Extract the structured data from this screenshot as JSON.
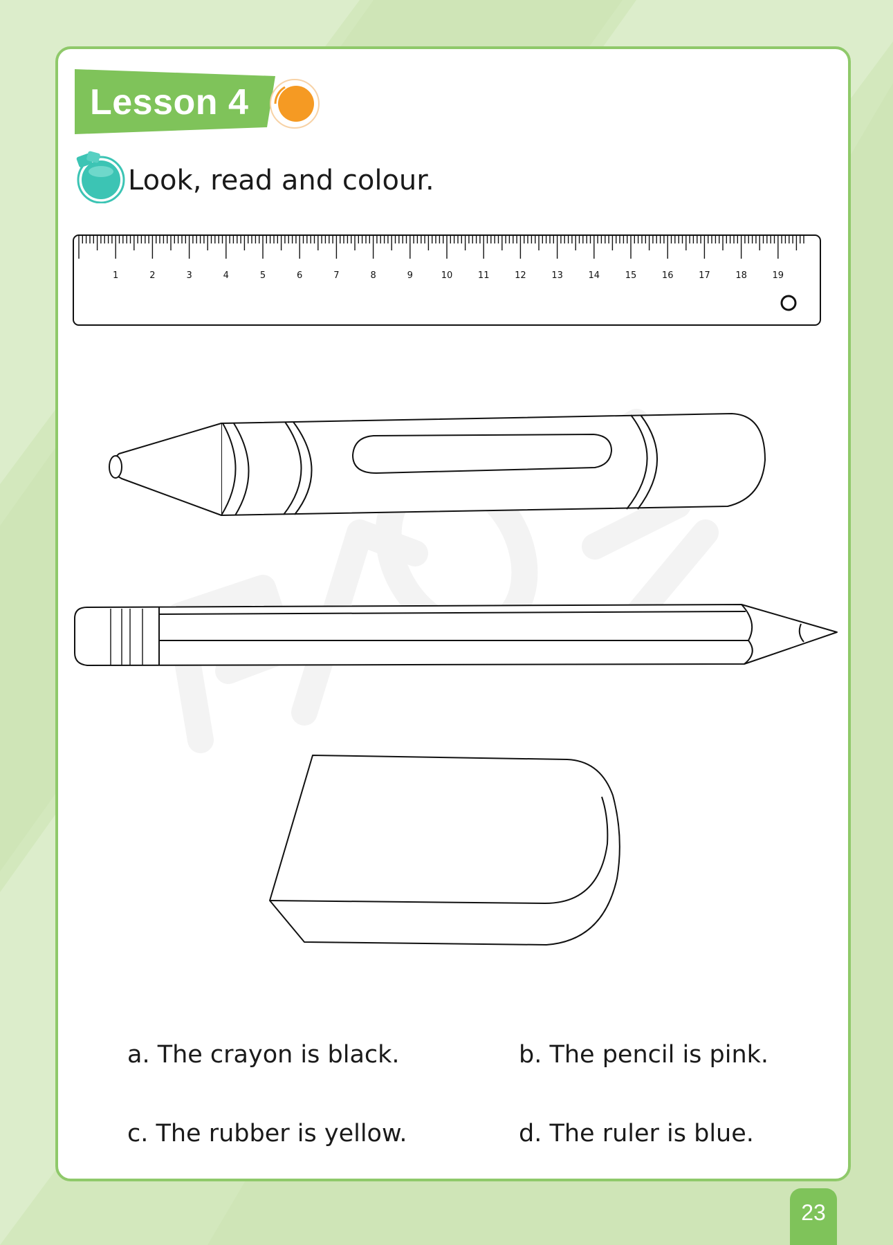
{
  "page": {
    "lesson_title": "Lesson 4",
    "instruction": "Look, read and colour.",
    "page_number": "23"
  },
  "ruler": {
    "ticks": [
      "1",
      "2",
      "3",
      "4",
      "5",
      "6",
      "7",
      "8",
      "9",
      "10",
      "11",
      "12",
      "13",
      "14",
      "15",
      "16",
      "17",
      "18",
      "19"
    ]
  },
  "sentences": [
    {
      "text": "a. The crayon is black."
    },
    {
      "text": "b. The pencil is pink."
    },
    {
      "text": "c. The rubber is yellow."
    },
    {
      "text": "d. The ruler is blue."
    }
  ],
  "colors": {
    "page_background": "#d3e8bd",
    "sheet_border": "#8fc96a",
    "banner_green": "#7fc35a",
    "lesson_dot_orange": "#f59a23",
    "icon_teal": "#3cc4b4"
  },
  "icons": {
    "lesson_marker": "orange-circle-icon",
    "instruction_marker": "teal-bubble-icon"
  }
}
